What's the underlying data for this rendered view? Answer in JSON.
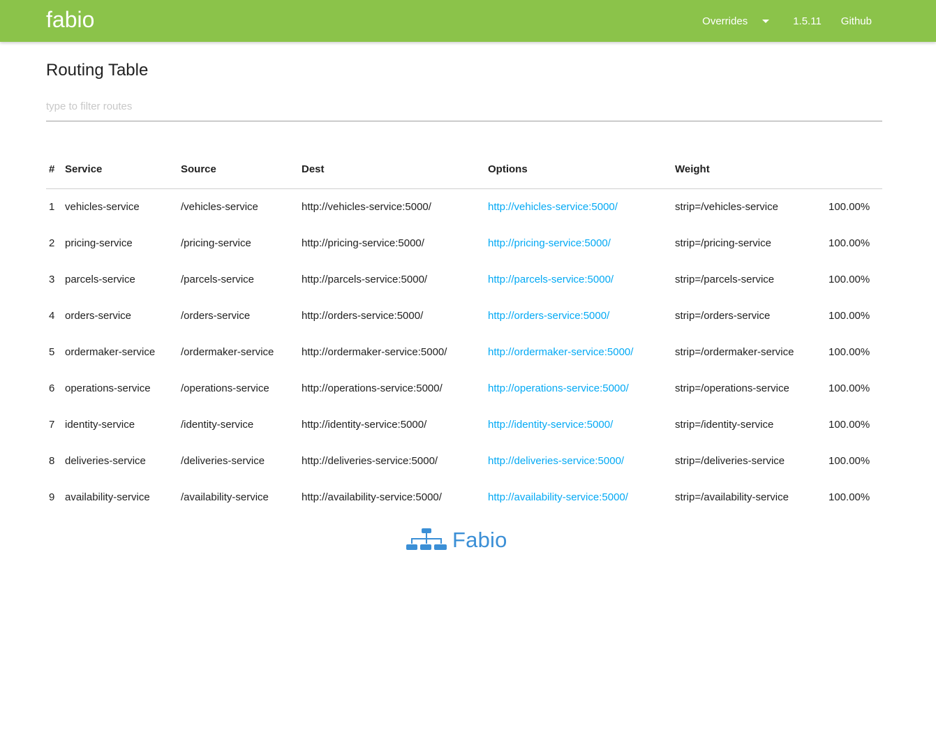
{
  "navbar": {
    "brand": "fabio",
    "overrides_label": "Overrides",
    "version": "1.5.11",
    "github_label": "Github",
    "color": "#8bc34a"
  },
  "main": {
    "title": "Routing Table",
    "filter": {
      "placeholder": "type to filter routes",
      "value": ""
    },
    "table": {
      "headers": {
        "num": "#",
        "service": "Service",
        "source": "Source",
        "dest": "Dest",
        "options": "Options",
        "weight": "Weight"
      },
      "rows": [
        {
          "num": "1",
          "service": "vehicles-service",
          "source": "/vehicles-service",
          "dest": "http://vehicles-service:5000/",
          "link": "http://vehicles-service:5000/",
          "options": "strip=/vehicles-service",
          "weight": "100.00%"
        },
        {
          "num": "2",
          "service": "pricing-service",
          "source": "/pricing-service",
          "dest": "http://pricing-service:5000/",
          "link": "http://pricing-service:5000/",
          "options": "strip=/pricing-service",
          "weight": "100.00%"
        },
        {
          "num": "3",
          "service": "parcels-service",
          "source": "/parcels-service",
          "dest": "http://parcels-service:5000/",
          "link": "http://parcels-service:5000/",
          "options": "strip=/parcels-service",
          "weight": "100.00%"
        },
        {
          "num": "4",
          "service": "orders-service",
          "source": "/orders-service",
          "dest": "http://orders-service:5000/",
          "link": "http://orders-service:5000/",
          "options": "strip=/orders-service",
          "weight": "100.00%"
        },
        {
          "num": "5",
          "service": "ordermaker-service",
          "source": "/ordermaker-service",
          "dest": "http://ordermaker-service:5000/",
          "link": "http://ordermaker-service:5000/",
          "options": "strip=/ordermaker-service",
          "weight": "100.00%"
        },
        {
          "num": "6",
          "service": "operations-service",
          "source": "/operations-service",
          "dest": "http://operations-service:5000/",
          "link": "http://operations-service:5000/",
          "options": "strip=/operations-service",
          "weight": "100.00%"
        },
        {
          "num": "7",
          "service": "identity-service",
          "source": "/identity-service",
          "dest": "http://identity-service:5000/",
          "link": "http://identity-service:5000/",
          "options": "strip=/identity-service",
          "weight": "100.00%"
        },
        {
          "num": "8",
          "service": "deliveries-service",
          "source": "/deliveries-service",
          "dest": "http://deliveries-service:5000/",
          "link": "http://deliveries-service:5000/",
          "options": "strip=/deliveries-service",
          "weight": "100.00%"
        },
        {
          "num": "9",
          "service": "availability-service",
          "source": "/availability-service",
          "dest": "http://availability-service:5000/",
          "link": "http://availability-service:5000/",
          "options": "strip=/availability-service",
          "weight": "100.00%"
        }
      ]
    }
  },
  "footer": {
    "logo_text": "Fabio",
    "logo_color": "#3b8fd6",
    "link_color": "#03a9f4"
  }
}
